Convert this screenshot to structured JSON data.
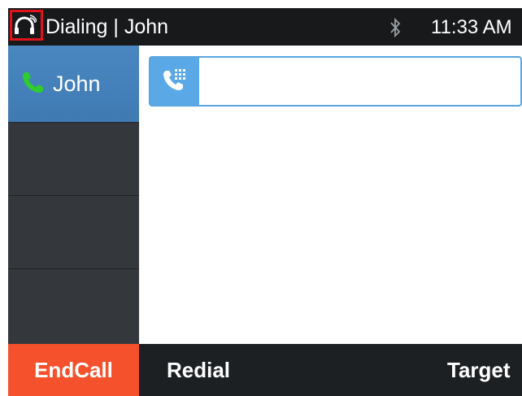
{
  "status_bar": {
    "title": "Dialing | John",
    "time": "11:33 AM",
    "icons": [
      "headset-icon",
      "bluetooth-icon"
    ],
    "highlight_color": "#e0121b"
  },
  "lines": {
    "active": {
      "name": "John",
      "icon": "phone-icon"
    },
    "empty_slots": 3
  },
  "dial_field": {
    "icon": "dialpad-phone-icon",
    "value": "",
    "placeholder": ""
  },
  "softkeys": {
    "end_call": "EndCall",
    "redial": "Redial",
    "target": "Target"
  },
  "colors": {
    "accent_blue": "#5aa9e6",
    "end_call_red": "#f4512c",
    "call_green": "#2ecc2e"
  }
}
